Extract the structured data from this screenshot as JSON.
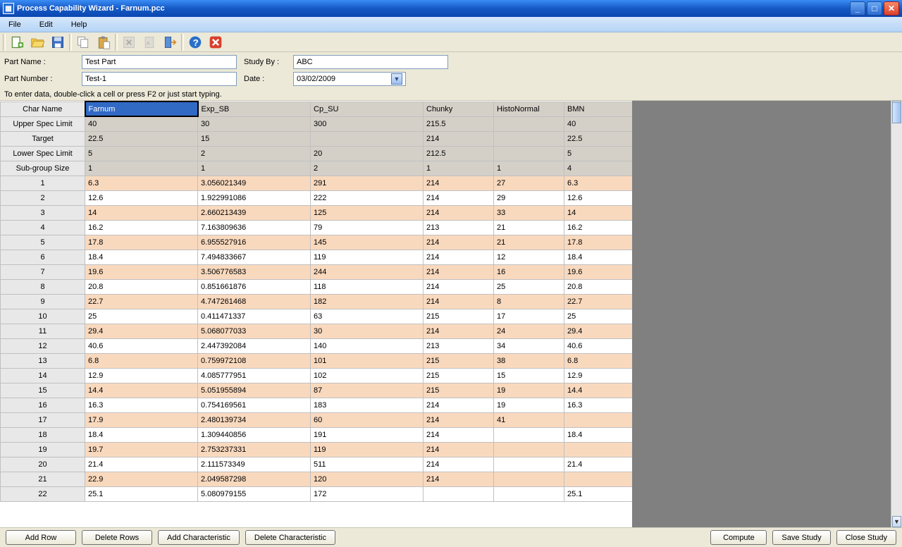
{
  "window": {
    "title": "Process Capability Wizard - Farnum.pcc"
  },
  "menu": {
    "items": [
      "File",
      "Edit",
      "Help"
    ]
  },
  "toolbar": {
    "icons": [
      "new-icon",
      "open-icon",
      "save-icon",
      "copy-icon",
      "paste-icon",
      "excel-icon",
      "pdf-icon",
      "exit-icon",
      "help-icon",
      "close-icon"
    ]
  },
  "form": {
    "part_name_label": "Part Name :",
    "part_name": "Test Part",
    "part_number_label": "Part Number :",
    "part_number": "Test-1",
    "study_by_label": "Study By :",
    "study_by": "ABC",
    "date_label": "Date :",
    "date": "03/02/2009"
  },
  "hint": "To enter data, double-click a cell or press F2 or just start typing.",
  "grid": {
    "row_header_label": "Char Name",
    "columns": [
      "Farnum",
      "Exp_SB",
      "Cp_SU",
      "Chunky",
      "HistoNormal",
      "BMN"
    ],
    "spec_rows": [
      {
        "label": "Upper Spec Limit",
        "values": [
          "40",
          "30",
          "300",
          "215.5",
          "",
          "40"
        ]
      },
      {
        "label": "Target",
        "values": [
          "22.5",
          "15",
          "",
          "214",
          "",
          "22.5"
        ]
      },
      {
        "label": "Lower Spec Limit",
        "values": [
          "5",
          "2",
          "20",
          "212.5",
          "",
          "5"
        ]
      },
      {
        "label": "Sub-group Size",
        "values": [
          "1",
          "1",
          "2",
          "1",
          "1",
          "4"
        ]
      }
    ],
    "data_rows": [
      [
        "6.3",
        "3.056021349",
        "291",
        "214",
        "27",
        "6.3"
      ],
      [
        "12.6",
        "1.922991086",
        "222",
        "214",
        "29",
        "12.6"
      ],
      [
        "14",
        "2.660213439",
        "125",
        "214",
        "33",
        "14"
      ],
      [
        "16.2",
        "7.163809636",
        "79",
        "213",
        "21",
        "16.2"
      ],
      [
        "17.8",
        "6.955527916",
        "145",
        "214",
        "21",
        "17.8"
      ],
      [
        "18.4",
        "7.494833667",
        "119",
        "214",
        "12",
        "18.4"
      ],
      [
        "19.6",
        "3.506776583",
        "244",
        "214",
        "16",
        "19.6"
      ],
      [
        "20.8",
        "0.851661876",
        "118",
        "214",
        "25",
        "20.8"
      ],
      [
        "22.7",
        "4.747261468",
        "182",
        "214",
        "8",
        "22.7"
      ],
      [
        "25",
        "0.411471337",
        "63",
        "215",
        "17",
        "25"
      ],
      [
        "29.4",
        "5.068077033",
        "30",
        "214",
        "24",
        "29.4"
      ],
      [
        "40.6",
        "2.447392084",
        "140",
        "213",
        "34",
        "40.6"
      ],
      [
        "6.8",
        "0.759972108",
        "101",
        "215",
        "38",
        "6.8"
      ],
      [
        "12.9",
        "4.085777951",
        "102",
        "215",
        "15",
        "12.9"
      ],
      [
        "14.4",
        "5.051955894",
        "87",
        "215",
        "19",
        "14.4"
      ],
      [
        "16.3",
        "0.754169561",
        "183",
        "214",
        "19",
        "16.3"
      ],
      [
        "17.9",
        "2.480139734",
        "60",
        "214",
        "41",
        ""
      ],
      [
        "18.4",
        "1.309440856",
        "191",
        "214",
        "",
        "18.4"
      ],
      [
        "19.7",
        "2.753237331",
        "119",
        "214",
        "",
        ""
      ],
      [
        "21.4",
        "2.111573349",
        "511",
        "214",
        "",
        "21.4"
      ],
      [
        "22.9",
        "2.049587298",
        "120",
        "214",
        "",
        ""
      ],
      [
        "25.1",
        "5.080979155",
        "172",
        "",
        "",
        "25.1"
      ]
    ]
  },
  "buttons": {
    "add_row": "Add Row",
    "delete_rows": "Delete Rows",
    "add_char": "Add Characteristic",
    "delete_char": "Delete Characteristic",
    "compute": "Compute",
    "save": "Save Study",
    "close": "Close Study"
  }
}
